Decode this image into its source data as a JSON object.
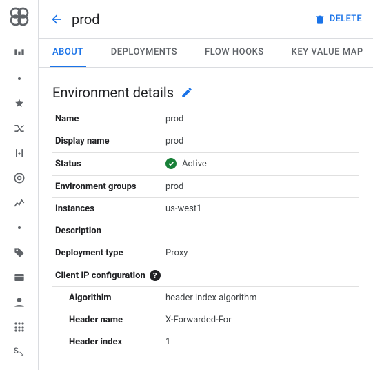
{
  "header": {
    "title": "prod",
    "delete_label": "DELETE"
  },
  "tabs": {
    "about": "ABOUT",
    "deployments": "DEPLOYMENTS",
    "flowhooks": "FLOW HOOKS",
    "kvm": "KEY VALUE MAP"
  },
  "section": {
    "title": "Environment details"
  },
  "details": {
    "name_label": "Name",
    "name_value": "prod",
    "display_label": "Display name",
    "display_value": "prod",
    "status_label": "Status",
    "status_value": "Active",
    "envgroups_label": "Environment groups",
    "envgroups_value": "prod",
    "instances_label": "Instances",
    "instances_value": "us-west1",
    "description_label": "Description",
    "description_value": "",
    "deptype_label": "Deployment type",
    "deptype_value": "Proxy",
    "clientip_label": "Client IP configuration",
    "algo_label": "Algorithim",
    "algo_value": "header index algorithm",
    "hname_label": "Header name",
    "hname_value": "X-Forwarded-For",
    "hidx_label": "Header index",
    "hidx_value": "1"
  }
}
